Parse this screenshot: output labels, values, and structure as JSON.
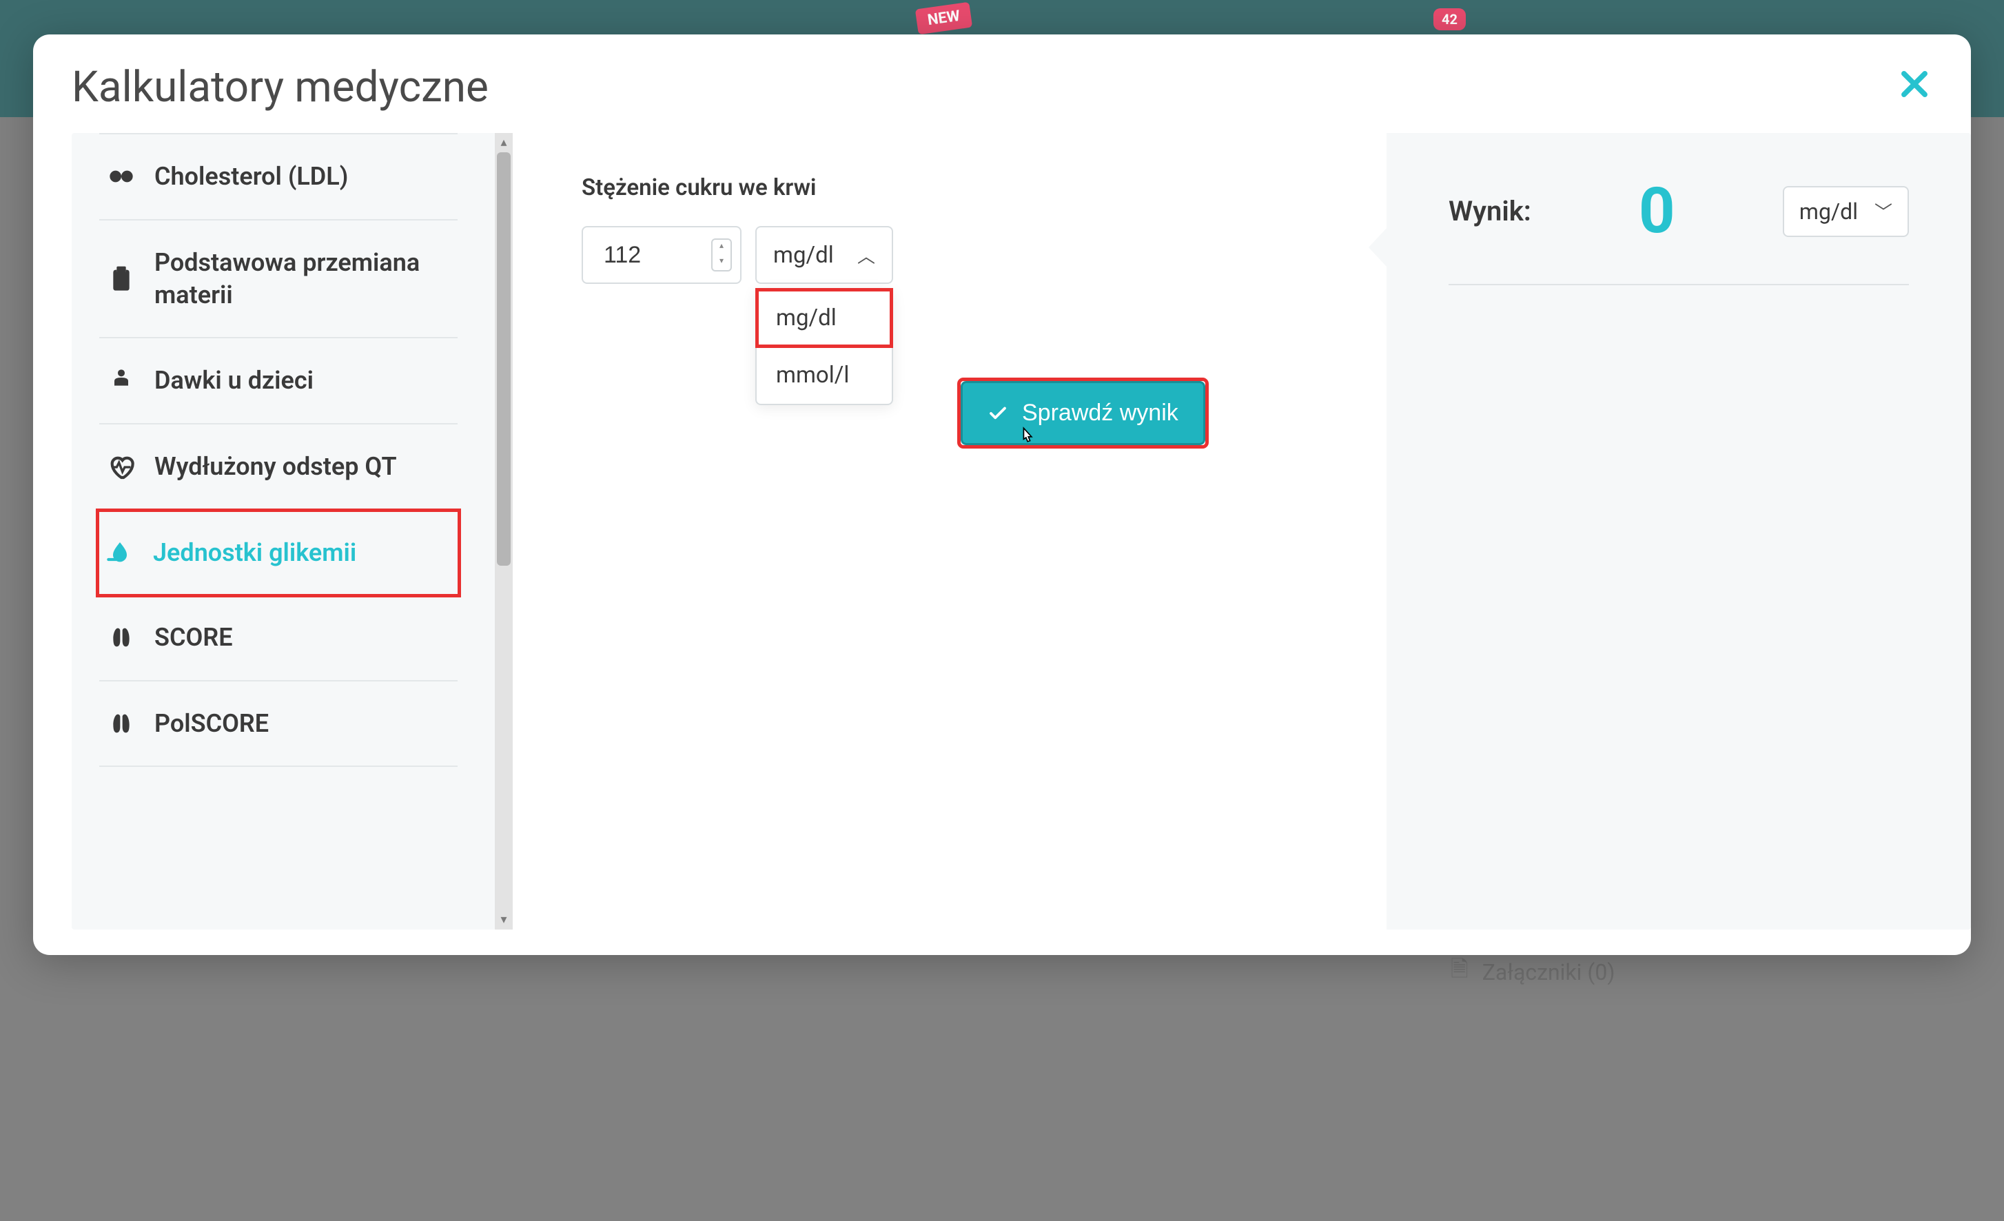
{
  "bg": {
    "new_badge": "NEW",
    "count_badge": "42",
    "attachments": "Załączniki (0)"
  },
  "modal": {
    "title": "Kalkulatory medyczne"
  },
  "sidebar": {
    "items": [
      {
        "label": "Cholesterol (LDL)",
        "icon": "eye-icon"
      },
      {
        "label": "Podstawowa przemiana materii",
        "icon": "clipboard-icon"
      },
      {
        "label": "Dawki u dzieci",
        "icon": "child-icon"
      },
      {
        "label": "Wydłużony odstep QT",
        "icon": "heartbeat-icon"
      },
      {
        "label": "Jednostki glikemii",
        "icon": "drop-icon"
      },
      {
        "label": "SCORE",
        "icon": "lungs-icon"
      },
      {
        "label": "PolSCORE",
        "icon": "lungs-icon"
      }
    ]
  },
  "form": {
    "field_label": "Stężenie cukru we krwi",
    "value": "112",
    "unit_selected": "mg/dl",
    "unit_options": [
      "mg/dl",
      "mmol/l"
    ],
    "submit": "Sprawdź wynik"
  },
  "result": {
    "label": "Wynik:",
    "value": "0",
    "unit": "mg/dl"
  }
}
